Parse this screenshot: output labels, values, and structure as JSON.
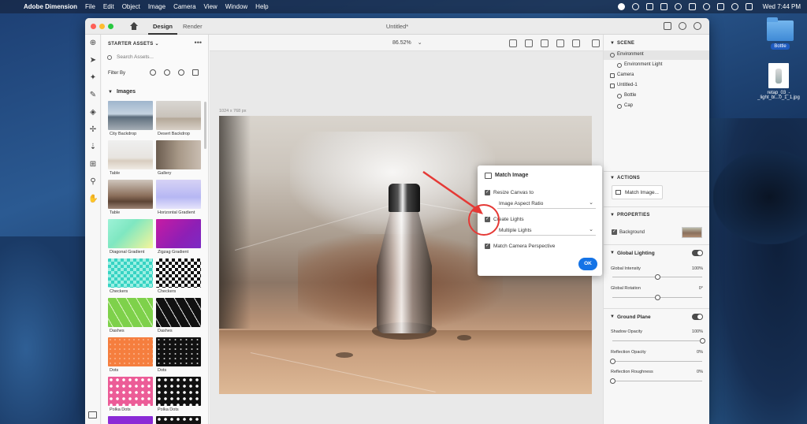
{
  "menubar": {
    "app_name": "Adobe Dimension",
    "items": [
      "File",
      "Edit",
      "Object",
      "Image",
      "Camera",
      "View",
      "Window",
      "Help"
    ],
    "clock": "Wed 7:44 PM"
  },
  "desktop": {
    "folder_label": "Bottle",
    "file_label_1": "retap_03_-",
    "file_label_2": "_light_bl...0_1_1.jpg"
  },
  "window": {
    "tab_design": "Design",
    "tab_render": "Render",
    "doc_title": "Untitled*"
  },
  "assets": {
    "header": "STARTER ASSETS",
    "header_caret": "⌄",
    "more": "•••",
    "search_placeholder": "Search Assets...",
    "filter_label": "Filter By",
    "section": "Images",
    "items": [
      {
        "label": "City Backdrop"
      },
      {
        "label": "Desert Backdrop"
      },
      {
        "label": "Table"
      },
      {
        "label": "Gallery"
      },
      {
        "label": "Table"
      },
      {
        "label": "Horizontal Gradient"
      },
      {
        "label": "Diagonal Gradient"
      },
      {
        "label": "Zigzag Gradient"
      },
      {
        "label": "Checkers"
      },
      {
        "label": "Checkers"
      },
      {
        "label": "Dashes"
      },
      {
        "label": "Dashes"
      },
      {
        "label": "Dots"
      },
      {
        "label": "Dots"
      },
      {
        "label": "Polka Dots"
      },
      {
        "label": "Polka Dots"
      }
    ]
  },
  "canvas": {
    "zoom": "86.52%",
    "zoom_caret": "⌄",
    "dims": "1024 x 768 px"
  },
  "match_image": {
    "title": "Match Image",
    "resize_canvas": "Resize Canvas to",
    "aspect_option": "Image Aspect Ratio",
    "create_lights": "Create Lights",
    "lights_option": "Multiple Lights",
    "match_perspective": "Match Camera Perspective",
    "ok": "OK"
  },
  "scene": {
    "header": "SCENE",
    "rows": [
      "Environment",
      "Environment Light",
      "Camera",
      "Untitled-1",
      "Bottle",
      "Cap"
    ]
  },
  "actions": {
    "header": "ACTIONS",
    "match_image_btn": "Match Image..."
  },
  "properties": {
    "header": "PROPERTIES",
    "background": "Background",
    "global_lighting": "Global Lighting",
    "global_intensity": "Global Intensity",
    "global_intensity_val": "100%",
    "global_rotation": "Global Rotation",
    "global_rotation_val": "0°",
    "ground_plane": "Ground Plane",
    "shadow_opacity": "Shadow Opacity",
    "shadow_opacity_val": "100%",
    "reflection_opacity": "Reflection Opacity",
    "reflection_opacity_val": "0%",
    "reflection_roughness": "Reflection Roughness",
    "reflection_roughness_val": "0%",
    "global_intensity_level": 0.5,
    "global_rotation_level": 0.5,
    "shadow_opacity_level": 1.0,
    "reflection_opacity_level": 0.0,
    "reflection_roughness_level": 0.0
  },
  "colors": {
    "accent_blue": "#1473e6",
    "annotation_red": "#e53935"
  }
}
